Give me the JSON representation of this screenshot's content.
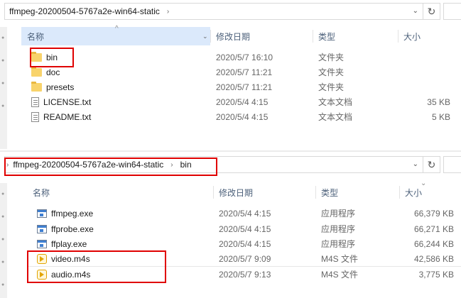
{
  "top": {
    "breadcrumb": {
      "folder": "ffmpeg-20200504-5767a2e-win64-static"
    },
    "columns": {
      "name": "名称",
      "date": "修改日期",
      "type": "类型",
      "size": "大小"
    },
    "files": [
      {
        "name": "bin",
        "date": "2020/5/7 16:10",
        "type": "文件夹",
        "size": "",
        "icon": "folder-icon"
      },
      {
        "name": "doc",
        "date": "2020/5/7 11:21",
        "type": "文件夹",
        "size": "",
        "icon": "folder-icon"
      },
      {
        "name": "presets",
        "date": "2020/5/7 11:21",
        "type": "文件夹",
        "size": "",
        "icon": "folder-icon"
      },
      {
        "name": "LICENSE.txt",
        "date": "2020/5/4 4:15",
        "type": "文本文档",
        "size": "35 KB",
        "icon": "text-file-icon"
      },
      {
        "name": "README.txt",
        "date": "2020/5/4 4:15",
        "type": "文本文档",
        "size": "5 KB",
        "icon": "text-file-icon"
      }
    ]
  },
  "bottom": {
    "breadcrumb": {
      "folder": "ffmpeg-20200504-5767a2e-win64-static",
      "subfolder": "bin"
    },
    "columns": {
      "name": "名称",
      "date": "修改日期",
      "type": "类型",
      "size": "大小"
    },
    "files": [
      {
        "name": "ffmpeg.exe",
        "date": "2020/5/4 4:15",
        "type": "应用程序",
        "size": "66,379 KB",
        "icon": "exe-icon"
      },
      {
        "name": "ffprobe.exe",
        "date": "2020/5/4 4:15",
        "type": "应用程序",
        "size": "66,271 KB",
        "icon": "exe-icon"
      },
      {
        "name": "ffplay.exe",
        "date": "2020/5/4 4:15",
        "type": "应用程序",
        "size": "66,244 KB",
        "icon": "exe-icon"
      },
      {
        "name": "video.m4s",
        "date": "2020/5/7 9:09",
        "type": "M4S 文件",
        "size": "42,586 KB",
        "icon": "media-file-icon"
      },
      {
        "name": "audio.m4s",
        "date": "2020/5/7 9:13",
        "type": "M4S 文件",
        "size": "3,775 KB",
        "icon": "media-file-icon"
      }
    ]
  },
  "colors": {
    "highlight": "#e00000",
    "sorted_header": "#dbe9fb",
    "folder": "#f8d36b"
  }
}
